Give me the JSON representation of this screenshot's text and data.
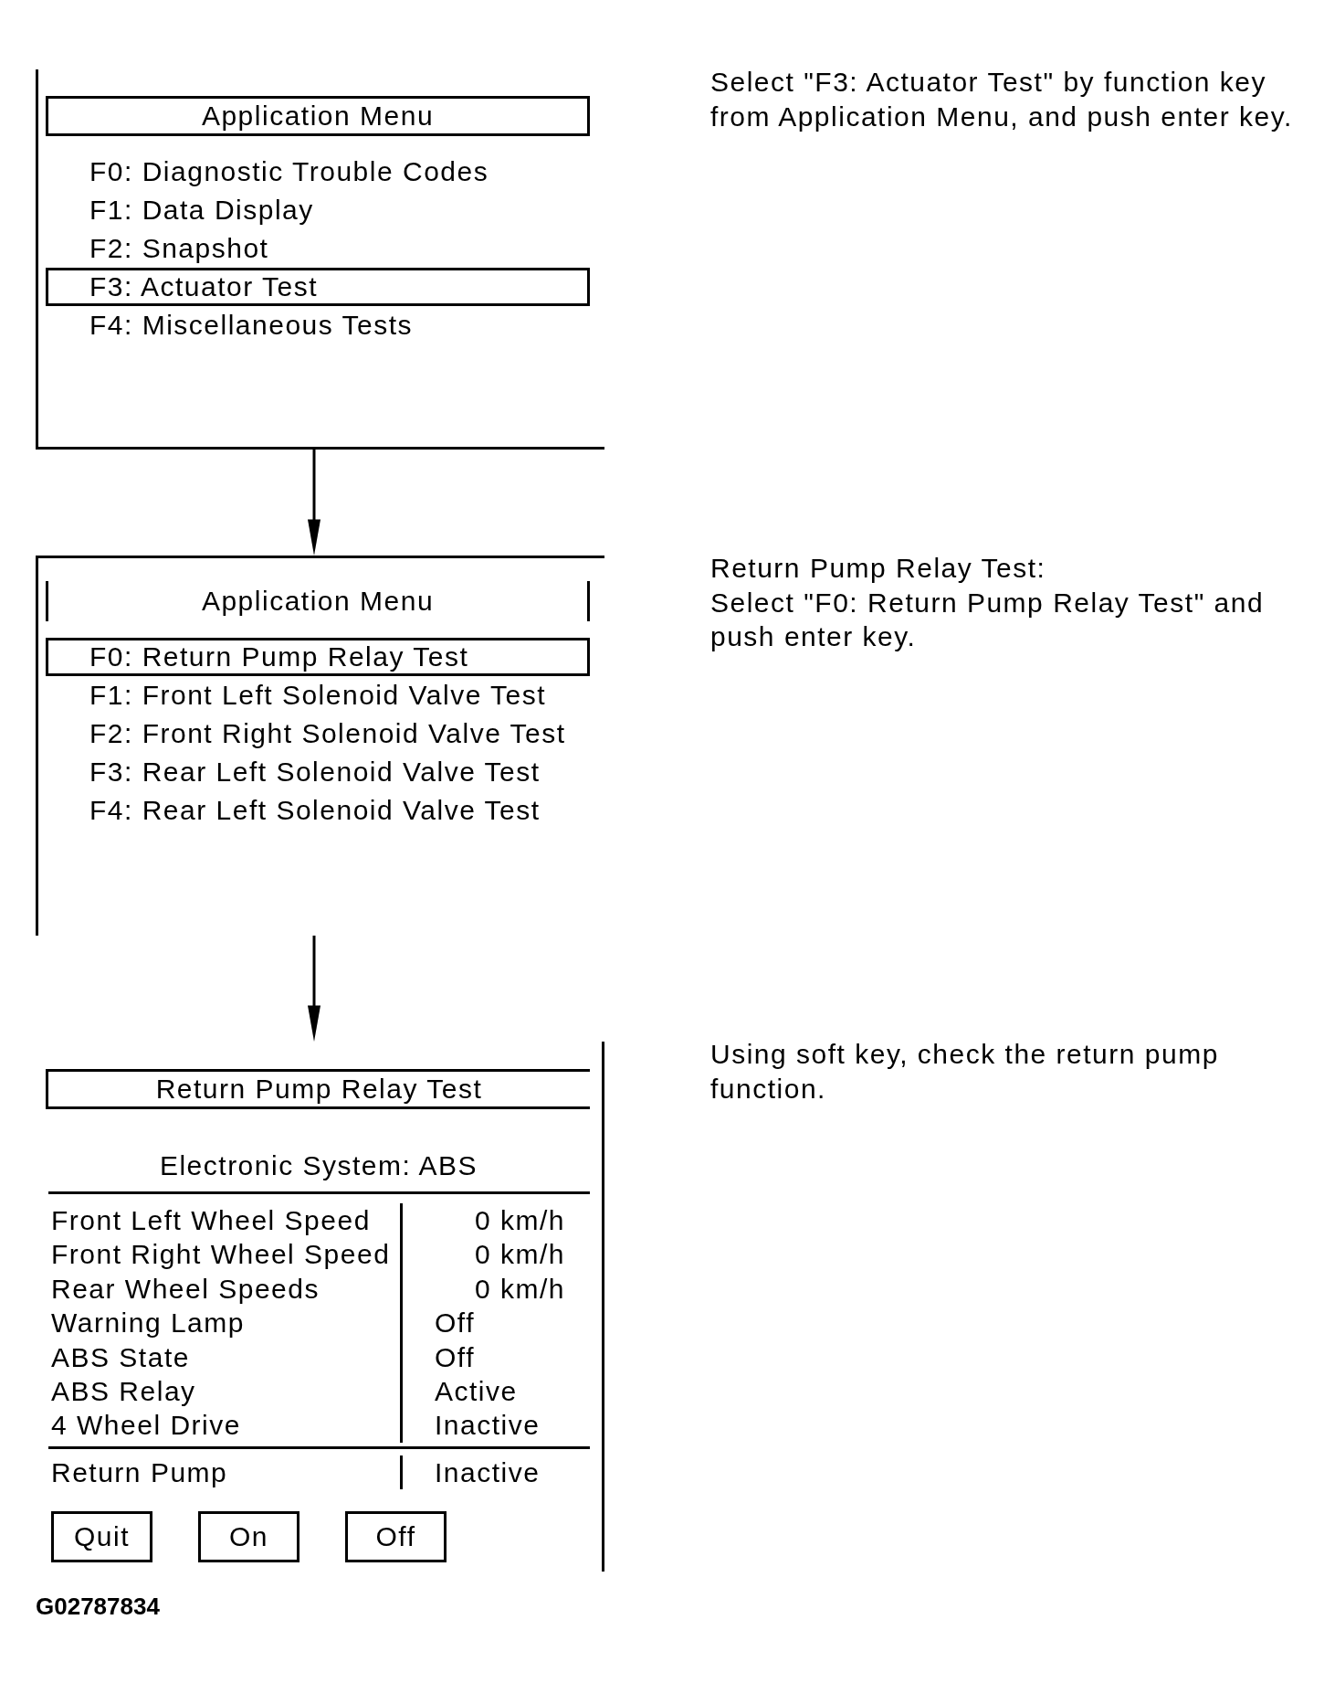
{
  "steps": [
    {
      "kind": "menu",
      "screen": {
        "title": "Application Menu",
        "items": [
          {
            "label": "F0: Diagnostic Trouble Codes",
            "selected": false
          },
          {
            "label": "F1: Data Display",
            "selected": false
          },
          {
            "label": "F2: Snapshot",
            "selected": false
          },
          {
            "label": "F3: Actuator Test",
            "selected": true
          },
          {
            "label": "F4: Miscellaneous Tests",
            "selected": false
          }
        ]
      },
      "instruction": [
        "Select \"F3: Actuator Test\" by function key from Application Menu, and push enter key."
      ]
    },
    {
      "kind": "menu",
      "screen": {
        "title": "Application Menu",
        "items": [
          {
            "label": "F0: Return Pump Relay Test",
            "selected": true
          },
          {
            "label": "F1: Front Left Solenoid Valve Test",
            "selected": false
          },
          {
            "label": "F2: Front Right Solenoid Valve Test",
            "selected": false
          },
          {
            "label": "F3: Rear Left Solenoid Valve Test",
            "selected": false
          },
          {
            "label": "F4: Rear Left Solenoid Valve Test",
            "selected": false
          }
        ]
      },
      "instruction": [
        "Return Pump Relay Test:",
        "Select \"F0: Return Pump Relay Test\" and push enter key."
      ]
    },
    {
      "kind": "test",
      "screen": {
        "title": "Return Pump Relay Test",
        "subtitle": "Electronic System: ABS",
        "readings": [
          {
            "kind": "speed",
            "name": "Front Left Wheel Speed",
            "value": "0 km/h"
          },
          {
            "kind": "speed",
            "name": "Front Right Wheel Speed",
            "value": "0 km/h"
          },
          {
            "kind": "speed",
            "name": "Rear Wheel Speeds",
            "value": "0 km/h"
          },
          {
            "kind": "state",
            "name": "Warning Lamp",
            "value": "Off"
          },
          {
            "kind": "state",
            "name": "ABS State",
            "value": "Off"
          },
          {
            "kind": "state",
            "name": "ABS Relay",
            "value": "Active"
          },
          {
            "kind": "state",
            "name": "4 Wheel Drive",
            "value": "Inactive"
          }
        ],
        "control": {
          "name": "Return Pump",
          "value": "Inactive"
        },
        "soft_keys": [
          "Quit",
          "On",
          "Off"
        ]
      },
      "instruction": [
        "Using soft key, check the return pump function."
      ]
    }
  ],
  "figure_id": "G02787834"
}
